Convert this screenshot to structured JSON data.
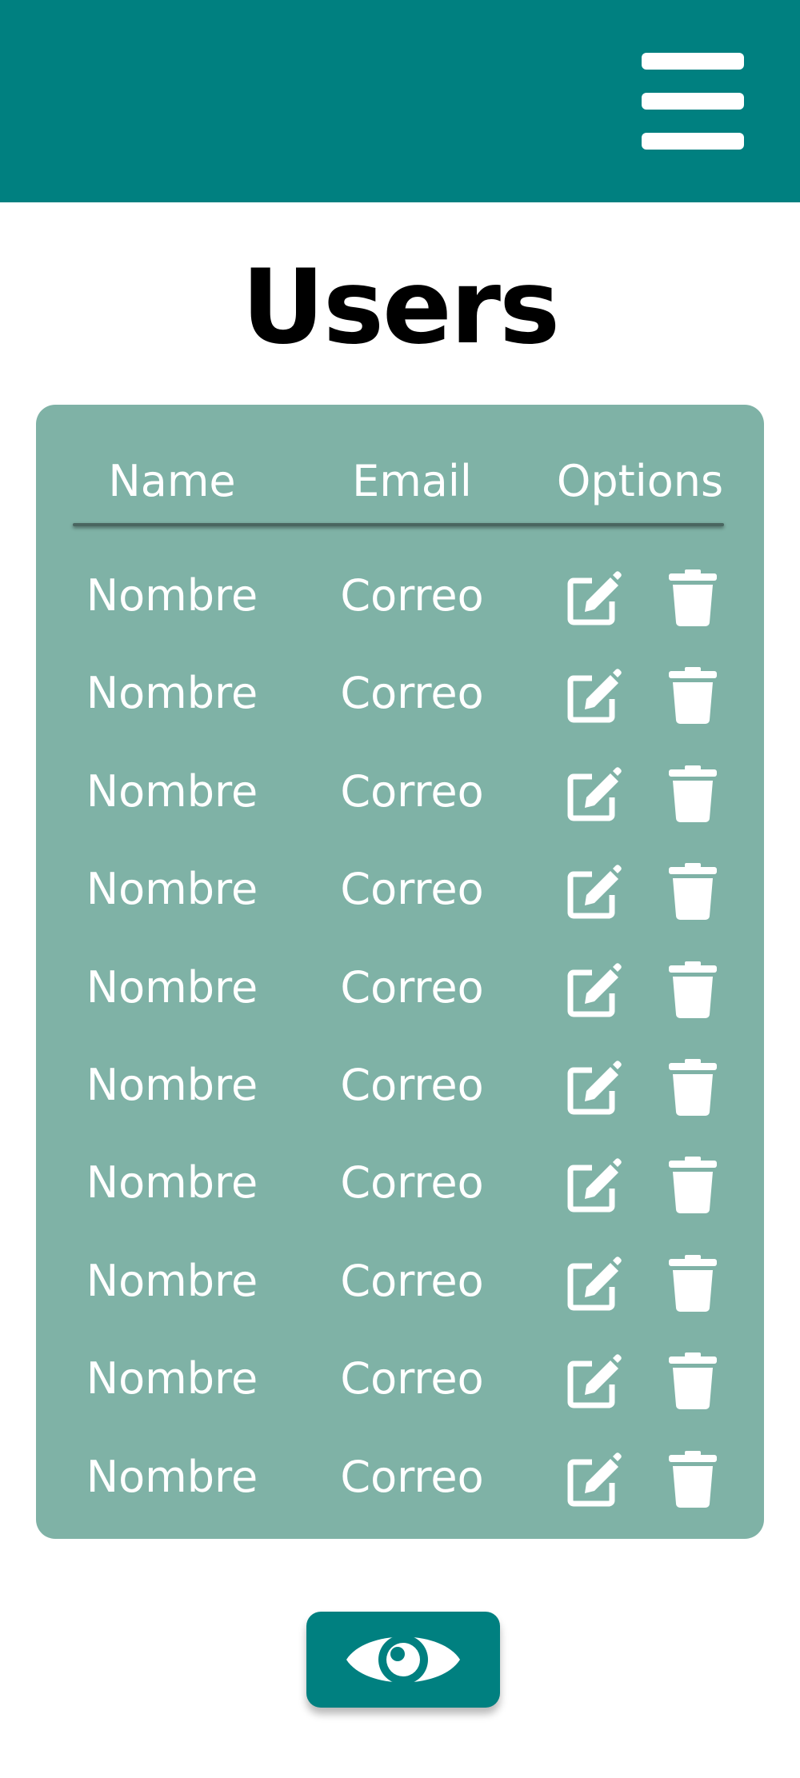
{
  "header": {
    "menu_icon": "hamburger-menu-icon",
    "background_color": "#008080"
  },
  "page": {
    "title": "Users"
  },
  "table": {
    "background_color": "#7fb2a6",
    "columns": {
      "name": "Name",
      "email": "Email",
      "options": "Options"
    },
    "rows": [
      {
        "name": "Nombre",
        "email": "Correo"
      },
      {
        "name": "Nombre",
        "email": "Correo"
      },
      {
        "name": "Nombre",
        "email": "Correo"
      },
      {
        "name": "Nombre",
        "email": "Correo"
      },
      {
        "name": "Nombre",
        "email": "Correo"
      },
      {
        "name": "Nombre",
        "email": "Correo"
      },
      {
        "name": "Nombre",
        "email": "Correo"
      },
      {
        "name": "Nombre",
        "email": "Correo"
      },
      {
        "name": "Nombre",
        "email": "Correo"
      },
      {
        "name": "Nombre",
        "email": "Correo"
      }
    ],
    "row_actions": [
      "edit-icon",
      "trash-icon"
    ]
  },
  "footer": {
    "view_button_icon": "eye-icon"
  }
}
